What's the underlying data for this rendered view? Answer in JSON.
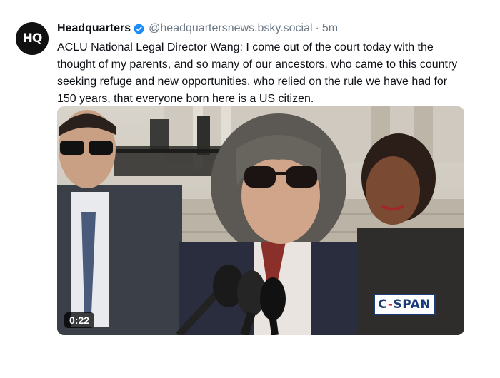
{
  "post": {
    "avatar_text": "HQ",
    "display_name": "Headquarters",
    "handle": "@headquartersnews.bsky.social",
    "separator": "·",
    "time": "5m",
    "text": "ACLU National Legal Director Wang: I come out of the court today with the thought of my parents, and so many of our ancestors, who came to this country seeking refuge and new opportunities, who relied on the rule we have had for 150 years, that everyone born here is a US citizen."
  },
  "video": {
    "duration": "0:22",
    "watermark_prefix": "C",
    "watermark_dash": "-",
    "watermark_suffix": "SPAN"
  },
  "colors": {
    "verified_badge": "#1d8cf8",
    "meta_text": "#6b7885",
    "cspan_blue": "#1a3d7a",
    "cspan_red": "#c8102e"
  },
  "icons": [
    "verified-badge-icon"
  ]
}
